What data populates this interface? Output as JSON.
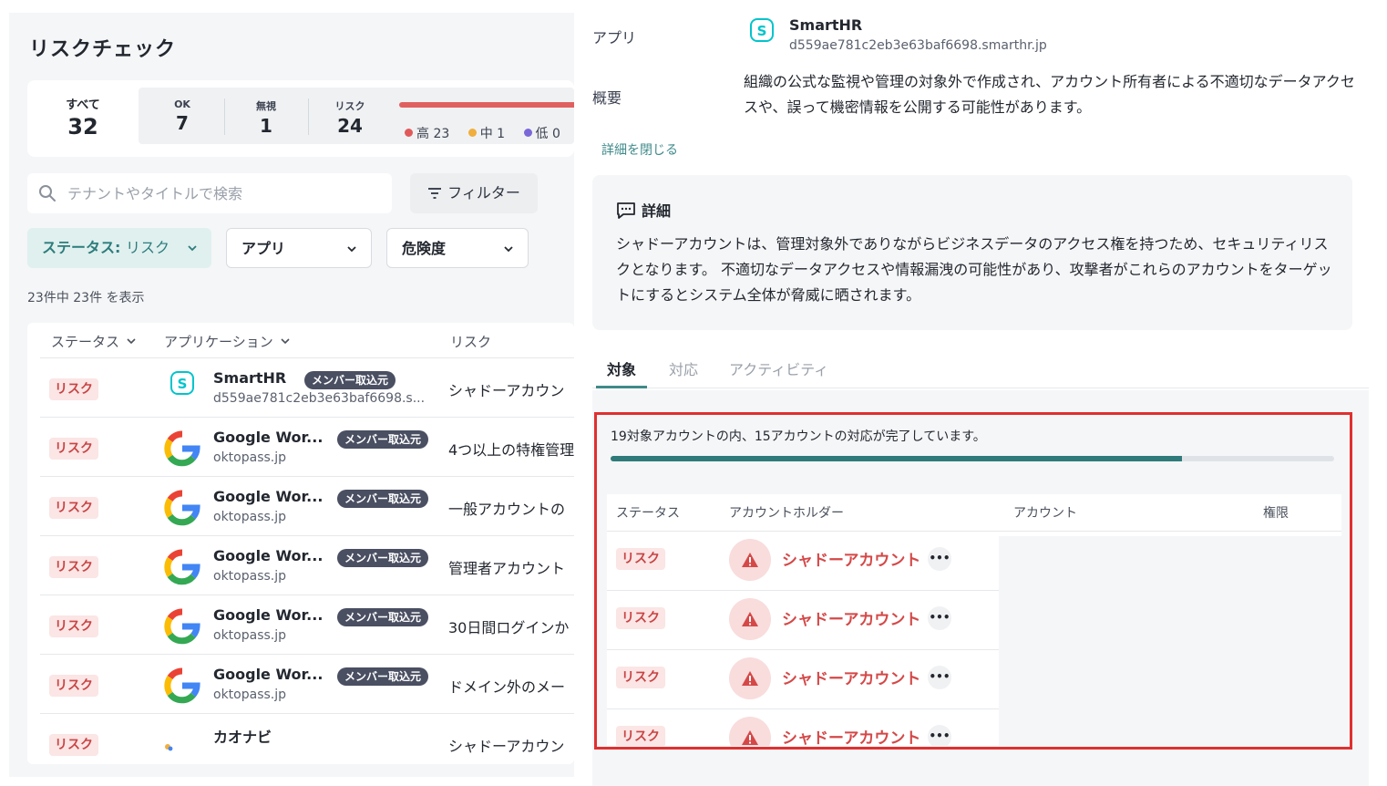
{
  "page": {
    "title": "リスクチェック"
  },
  "summary": {
    "all": {
      "label": "すべて",
      "value": "32"
    },
    "ok": {
      "label": "OK",
      "value": "7"
    },
    "ignored": {
      "label": "無視",
      "value": "1"
    },
    "risk": {
      "label": "リスク",
      "value": "24"
    },
    "levels": [
      {
        "label": "高 23",
        "color": "#e05a5a"
      },
      {
        "label": "中 1",
        "color": "#f0ae3c"
      },
      {
        "label": "低 0",
        "color": "#7a68d8"
      }
    ]
  },
  "search": {
    "placeholder": "テナントやタイトルで検索",
    "value": ""
  },
  "filter": {
    "label": "フィルター"
  },
  "dropdowns": {
    "status_label": "ステータス:",
    "status_value": "リスク",
    "app": "アプリ",
    "severity": "危険度"
  },
  "result_count": "23件中 23件 を表示",
  "table": {
    "headers": {
      "status": "ステータス",
      "application": "アプリケーション",
      "risk": "リスク"
    },
    "rows": [
      {
        "status": "リスク",
        "app": "SmartHR",
        "tag": "メンバー取込元",
        "domain": "d559ae781c2eb3e63baf6698.s...",
        "risk": "シャドーアカウン",
        "logo": "smarthr"
      },
      {
        "status": "リスク",
        "app": "Google Wor...",
        "tag": "メンバー取込元",
        "domain": "oktopass.jp",
        "risk": "4つ以上の特権管理",
        "logo": "google"
      },
      {
        "status": "リスク",
        "app": "Google Wor...",
        "tag": "メンバー取込元",
        "domain": "oktopass.jp",
        "risk": "一般アカウントの",
        "logo": "google"
      },
      {
        "status": "リスク",
        "app": "Google Wor...",
        "tag": "メンバー取込元",
        "domain": "oktopass.jp",
        "risk": "管理者アカウント",
        "logo": "google"
      },
      {
        "status": "リスク",
        "app": "Google Wor...",
        "tag": "メンバー取込元",
        "domain": "oktopass.jp",
        "risk": "30日間ログインか",
        "logo": "google"
      },
      {
        "status": "リスク",
        "app": "Google Wor...",
        "tag": "メンバー取込元",
        "domain": "oktopass.jp",
        "risk": "ドメイン外のメー",
        "logo": "google"
      },
      {
        "status": "リスク",
        "app": "カオナビ",
        "tag": "",
        "domain": "",
        "risk": "シャドーアカウン",
        "logo": "kaonavi"
      }
    ]
  },
  "detail": {
    "app_label": "アプリ",
    "app_name": "SmartHR",
    "app_domain": "d559ae781c2eb3e63baf6698.smarthr.jp",
    "summary_label": "概要",
    "summary_text": "組織の公式な監視や管理の対象外で作成され、アカウント所有者による不適切なデータアクセスや、誤って機密情報を公開する可能性があります。",
    "close_link": "詳細を閉じる",
    "detail_heading": "詳細",
    "detail_text": "シャドーアカウントは、管理対象外でありながらビジネスデータのアクセス権を持つため、セキュリティリスクとなります。 不適切なデータアクセスや情報漏洩の可能性があり、攻撃者がこれらのアカウントをターゲットにするとシステム全体が脅威に晒されます。",
    "tabs": [
      "対象",
      "対応",
      "アクティビティ"
    ],
    "progress_text": "19対象アカウントの内、15アカウントの対応が完了しています。",
    "progress_fraction": 0.79,
    "account_headers": {
      "status": "ステータス",
      "holder": "アカウントホルダー",
      "account": "アカウント",
      "permission": "権限"
    },
    "accounts": [
      {
        "status": "リスク",
        "holder": "シャドーアカウント"
      },
      {
        "status": "リスク",
        "holder": "シャドーアカウント"
      },
      {
        "status": "リスク",
        "holder": "シャドーアカウント"
      },
      {
        "status": "リスク",
        "holder": "シャドーアカウント"
      }
    ]
  },
  "colors": {
    "accent": "#3f8a8a",
    "risk": "#d54848",
    "highlight_box": "#e03030"
  }
}
